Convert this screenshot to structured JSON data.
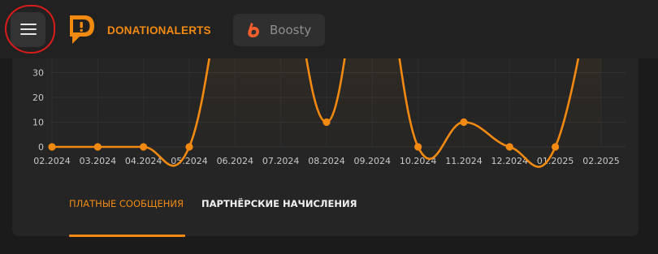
{
  "header": {
    "menu_icon": "hamburger-menu-icon",
    "donationalerts_label": "DONATIONALERTS",
    "boosty_label": "Boosty",
    "colors": {
      "accent": "#f28a12",
      "boosty": "#f15f2c"
    }
  },
  "chart_data": {
    "type": "line",
    "x": [
      "02.2024",
      "03.2024",
      "04.2024",
      "05.2024",
      "06.2024",
      "07.2024",
      "08.2024",
      "09.2024",
      "10.2024",
      "11.2024",
      "12.2024",
      "01.2025",
      "02.2025"
    ],
    "y_ticks": [
      "0",
      "10",
      "20",
      "30"
    ],
    "series": [
      {
        "values": [
          0,
          0,
          0,
          0,
          null,
          null,
          10,
          null,
          0,
          10,
          0,
          0,
          null
        ],
        "color": "#f28a12"
      }
    ],
    "note_visible": "values for 06.2024, 07.2024, 09.2024 and 02.2025 exceed the visible range (above 30)",
    "grid": true
  },
  "tabs": [
    {
      "label": "ПЛАТНЫЕ СООБЩЕНИЯ",
      "active": true
    },
    {
      "label": "ПАРТНЁРСКИЕ НАЧИСЛЕНИЯ",
      "active": false
    }
  ]
}
